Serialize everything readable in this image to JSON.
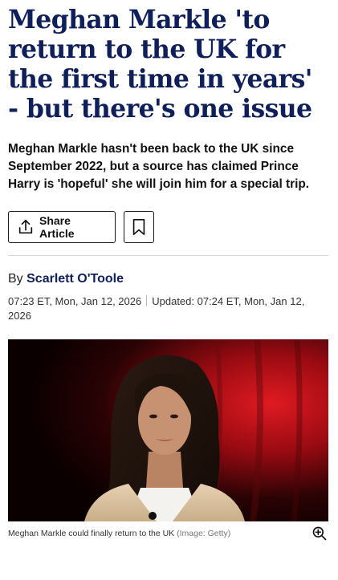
{
  "article": {
    "headline": "Meghan Markle 'to return to the UK for the first time in years' - but there's one issue",
    "standfirst": "Meghan Markle hasn't been back to the UK since September 2022, but a source has claimed Prince Harry is 'hopeful' she will join him for a special trip.",
    "byline_prefix": "By ",
    "author": "Scarlett O'Toole",
    "published": "07:23 ET, Mon, Jan 12, 2026",
    "updated": "Updated: 07:24 ET, Mon, Jan 12, 2026"
  },
  "actions": {
    "share_label": "Share Article",
    "share_icon": "share-upload-icon",
    "bookmark_icon": "bookmark-icon"
  },
  "image": {
    "caption": "Meghan Markle could finally return to the UK",
    "credit": "(Image: Getty)",
    "zoom_icon": "zoom-in-icon"
  },
  "colors": {
    "headline": "#0f1f5a",
    "author": "#0f1f5a",
    "backdrop": "#c8111a"
  }
}
